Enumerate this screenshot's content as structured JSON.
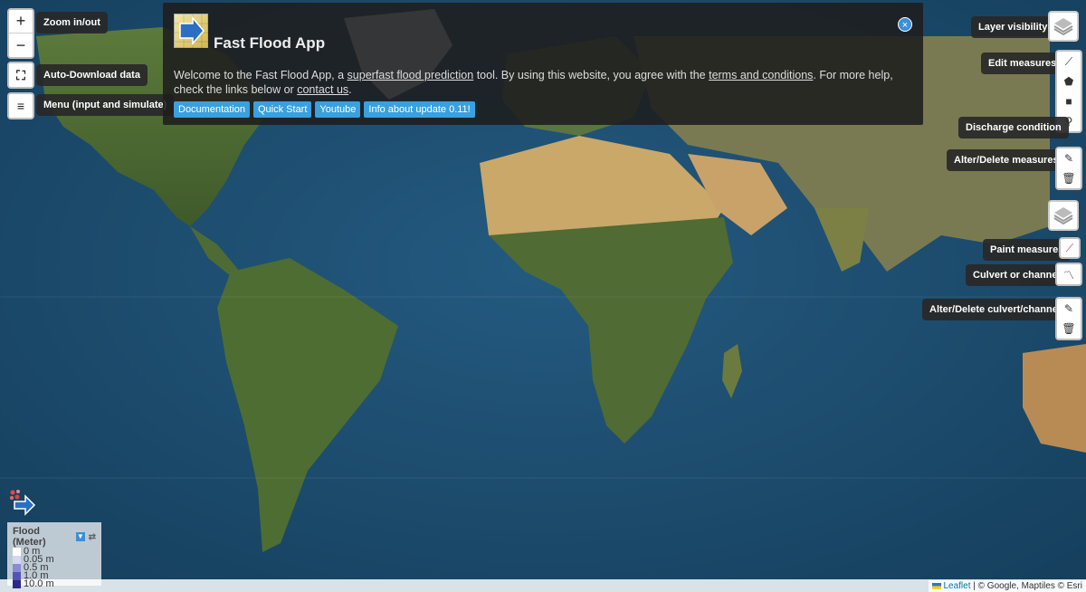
{
  "left_controls": {
    "zoom_in": "+",
    "zoom_out": "−",
    "zoom_tip": "Zoom in/out",
    "download_tip": "Auto-Download data",
    "menu_tip": "Menu (input and simulate)"
  },
  "welcome": {
    "title": "Fast Flood App",
    "close": "×",
    "desc_part1": "Welcome to the Fast Flood App, a ",
    "link_prediction": "superfast flood prediction",
    "desc_part2": " tool. By using this website, you agree with the ",
    "link_terms": "terms and conditions",
    "desc_part3": ". For more help, check the links below or ",
    "link_contact": "contact us",
    "desc_part4": ".",
    "buttons": [
      "Documentation",
      "Quick Start",
      "Youtube",
      "Info about update 0.11!"
    ]
  },
  "right_controls": {
    "layer_tip": "Layer visibility",
    "edit_tip": "Edit measures",
    "discharge_tip": "Discharge condition",
    "alter_tip": "Alter/Delete measures",
    "paint_tip": "Paint measures",
    "culvert_tip": "Culvert or channel",
    "alter_culvert_tip": "Alter/Delete culvert/channel"
  },
  "legend": {
    "title": "Flood (Meter)",
    "entries": [
      {
        "label": "0 m",
        "color": "#ffffff"
      },
      {
        "label": "0.05 m",
        "color": "#d6d6f2"
      },
      {
        "label": "0.5 m",
        "color": "#8a8ad6"
      },
      {
        "label": "1.0 m",
        "color": "#5454b8"
      },
      {
        "label": "10.0 m",
        "color": "#2b2b8a"
      }
    ]
  },
  "attribution": {
    "leaflet": "Leaflet",
    "rest": " | © Google, Maptiles © Esri"
  },
  "colors": {
    "accent": "#3aa0de",
    "ocean": "#1d4a6b",
    "land_green": "#4f6b35",
    "land_desert": "#c9a86a"
  }
}
